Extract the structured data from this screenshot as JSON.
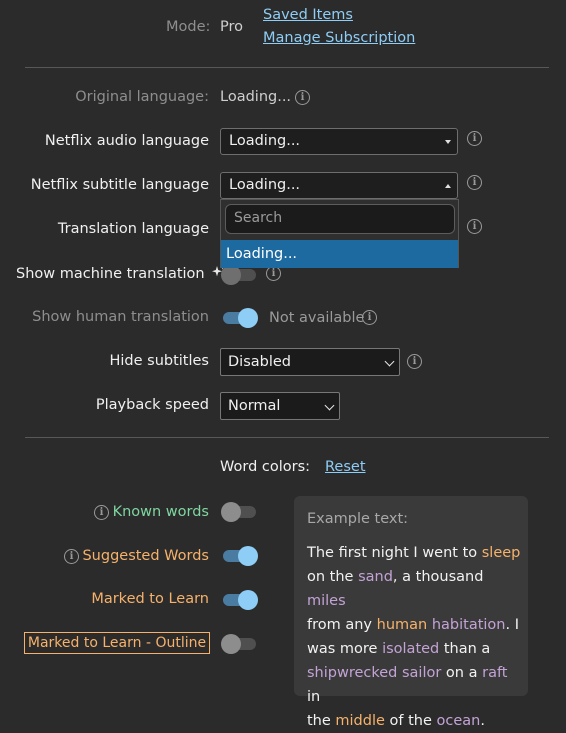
{
  "header": {
    "mode_label": "Mode:",
    "mode_value": "Pro",
    "saved_items": "Saved Items",
    "manage_subscription": "Manage Subscription"
  },
  "settings": {
    "original_language": {
      "label": "Original language:",
      "value": "Loading..."
    },
    "netflix_audio_language": {
      "label": "Netflix audio language",
      "value": "Loading..."
    },
    "netflix_subtitle_language": {
      "label": "Netflix subtitle language",
      "value": "Loading..."
    },
    "subtitle_dropdown": {
      "search_placeholder": "Search",
      "option": "Loading..."
    },
    "translation_language": {
      "label": "Translation language"
    },
    "show_machine_translation": {
      "label": "Show machine translation",
      "icon": "sparkle-icon",
      "on": false
    },
    "show_human_translation": {
      "label": "Show human translation",
      "on": true,
      "status": "Not available"
    },
    "hide_subtitles": {
      "label": "Hide subtitles",
      "value": "Disabled"
    },
    "playback_speed": {
      "label": "Playback speed",
      "value": "Normal"
    }
  },
  "word_colors": {
    "label": "Word colors:",
    "reset": "Reset",
    "rows": [
      {
        "label": "Known words",
        "color": "#7fd6a0",
        "on": false,
        "info": true
      },
      {
        "label": "Suggested Words",
        "color": "#f6b26b",
        "on": true,
        "info": true
      },
      {
        "label": "Marked to Learn",
        "color": "#f6b26b",
        "on": true,
        "info": false
      },
      {
        "label": "Marked to Learn - Outline",
        "color": "#f6b26b",
        "on": false,
        "info": false
      }
    ],
    "example": {
      "title": "Example text:",
      "line1": [
        "The first night I went to ",
        "sleep"
      ],
      "line2": [
        "on the ",
        "sand",
        ", a thousand ",
        "miles"
      ],
      "line3": [
        "from any ",
        "human",
        " ",
        "habitation",
        ". I"
      ],
      "line4": [
        "was more ",
        "isolated",
        " than a"
      ],
      "line5": [
        "shipwrecked sailor",
        " on a ",
        "raft",
        " in"
      ],
      "line6": [
        "the ",
        "middle",
        " of the ",
        "ocean",
        "."
      ]
    }
  },
  "colors": {
    "accent": "#8ecdf5",
    "highlight": "#1d6aa0",
    "orange": "#f6b26b",
    "purple": "#c3a3d6",
    "green": "#7fd6a0"
  }
}
